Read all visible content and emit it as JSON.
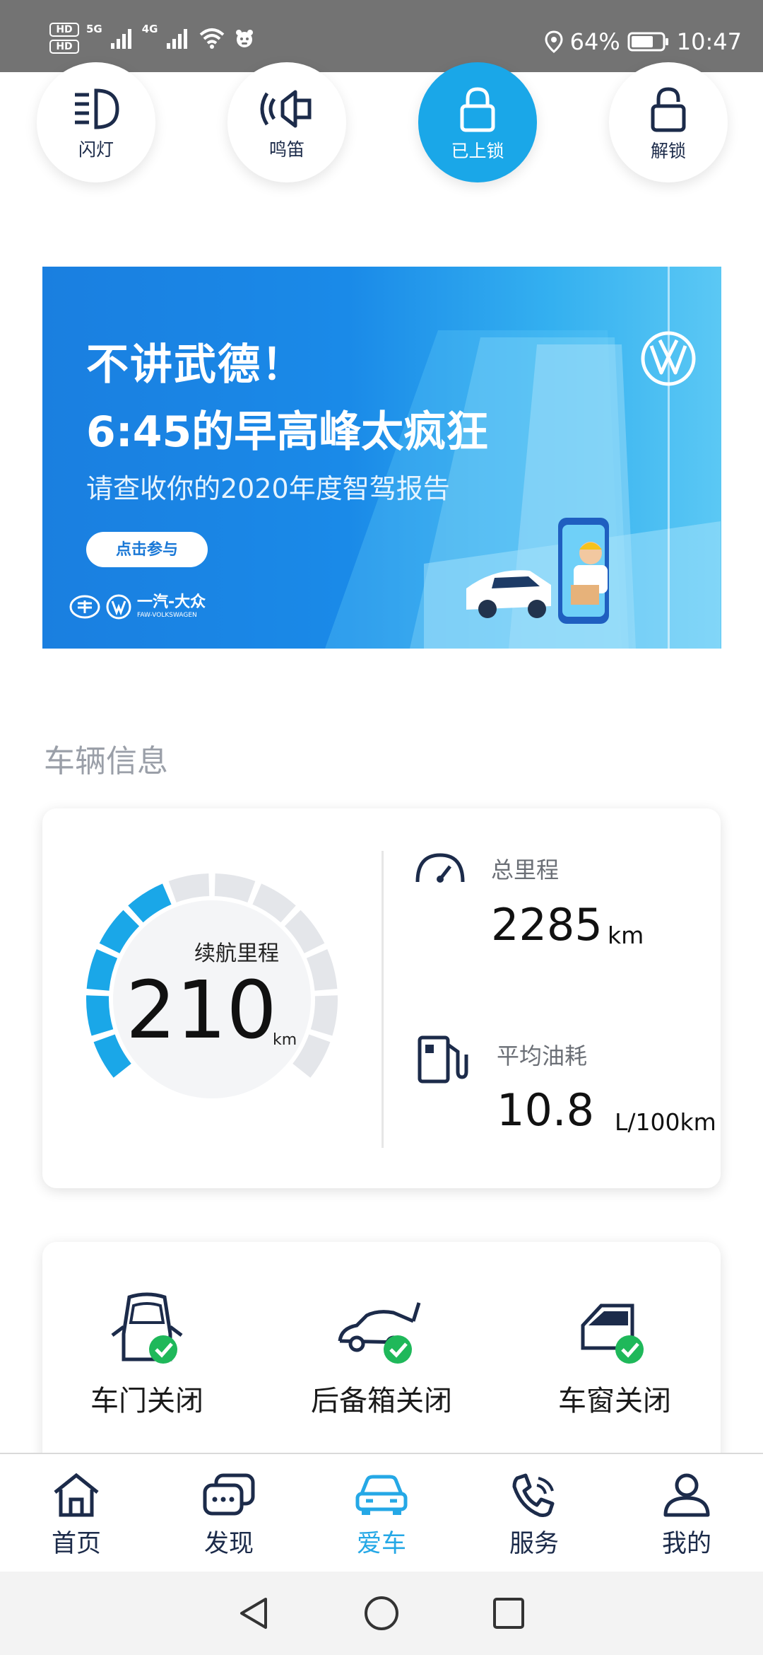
{
  "status_bar": {
    "hd1": "HD",
    "hd2": "HD",
    "net1": "5G",
    "net2": "4G",
    "battery": "64%",
    "time": "10:47"
  },
  "quick_actions": [
    {
      "label": "闪灯",
      "icon": "headlight-icon",
      "active": false
    },
    {
      "label": "鸣笛",
      "icon": "horn-icon",
      "active": false
    },
    {
      "label": "已上锁",
      "icon": "lock-icon",
      "active": true
    },
    {
      "label": "解锁",
      "icon": "unlock-icon",
      "active": false
    }
  ],
  "banner": {
    "line1": "不讲武德！",
    "line2": "6:45的早高峰太疯狂",
    "line3": "请查收你的2020年度智驾报告",
    "button": "点击参与",
    "brand": "一汽-大众",
    "brand_sub": "FAW-VOLKSWAGEN"
  },
  "vehicle_info": {
    "title": "车辆信息",
    "range_label": "续航里程",
    "range_value": "210",
    "range_unit": "km",
    "range_level": 0.42,
    "odometer_label": "总里程",
    "odometer_value": "2285",
    "odometer_unit": "km",
    "fuel_label": "平均油耗",
    "fuel_value": "10.8",
    "fuel_unit": "L/100km"
  },
  "car_status": [
    {
      "label": "车门关闭",
      "icon": "car-door-icon"
    },
    {
      "label": "后备箱关闭",
      "icon": "trunk-icon"
    },
    {
      "label": "车窗关闭",
      "icon": "car-window-icon"
    }
  ],
  "bottom_nav": [
    {
      "label": "首页",
      "icon": "home-icon",
      "active": false
    },
    {
      "label": "发现",
      "icon": "chat-bubbles-icon",
      "active": false
    },
    {
      "label": "爱车",
      "icon": "car-icon",
      "active": true
    },
    {
      "label": "服务",
      "icon": "phone-icon",
      "active": false
    },
    {
      "label": "我的",
      "icon": "profile-icon",
      "active": false
    }
  ],
  "colors": {
    "accent": "#1aa7e8",
    "nav_active": "#25a8e6",
    "check_green": "#1fb85a",
    "icon_dark": "#1c2b4a"
  }
}
